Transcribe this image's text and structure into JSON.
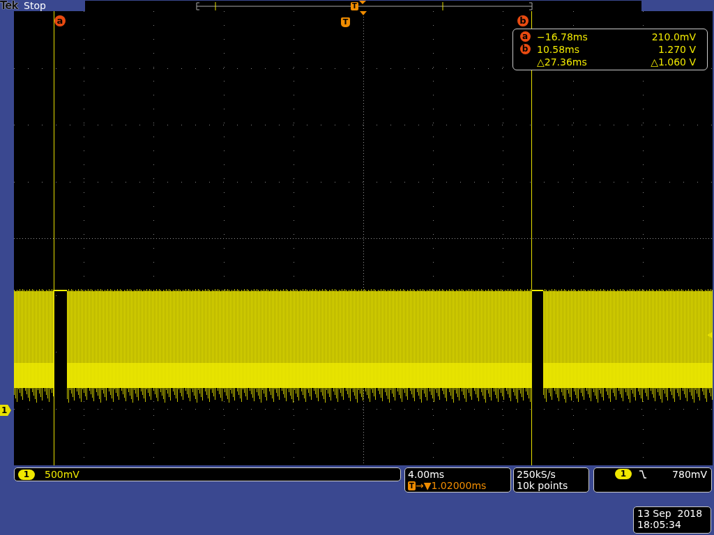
{
  "status": {
    "brand": "Tek",
    "run_state": "Stop",
    "overview_trigger": "T"
  },
  "graticule": {
    "trigger_marker": "T",
    "channel_marker": "1"
  },
  "cursors": [
    {
      "marker_label": "a",
      "readout_label": "a",
      "time": "−16.78ms",
      "value": "210.0mV"
    },
    {
      "marker_label": "b",
      "readout_label": "b",
      "time": "10.58ms",
      "value": "1.270 V"
    }
  ],
  "cursor_delta": {
    "time": "△27.36ms",
    "value": "△1.060 V"
  },
  "channel": {
    "number": "1",
    "scale": "500mV"
  },
  "horizontal": {
    "scale": "4.00ms",
    "trigger_badge": "T",
    "delay": "→▼1.02000ms"
  },
  "acquisition": {
    "sample_rate": "250kS/s",
    "record_length": "10k points"
  },
  "trigger": {
    "source": "1",
    "falling_edge": true,
    "level": "780mV"
  },
  "datetime": {
    "date": "13 Sep  2018",
    "time": "18:05:34"
  }
}
